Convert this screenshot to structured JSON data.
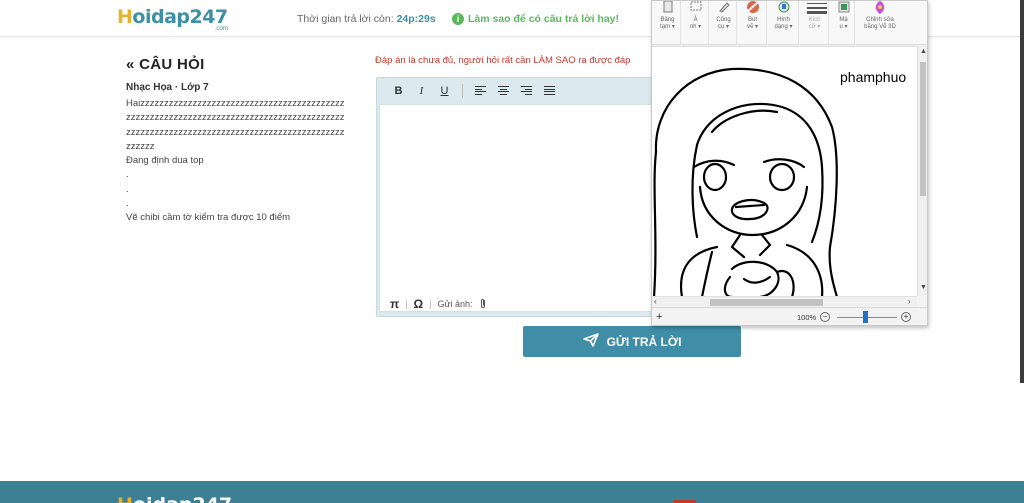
{
  "header": {
    "logo_h": "H",
    "logo_rest": "oidap247",
    "logo_com": ".com",
    "timer_label": "Thời gian trả lời còn:",
    "timer_value": "24p:29s",
    "tip": "Làm sao để có câu trả lời hay!"
  },
  "question": {
    "title": "CÂU HỎI",
    "subject": "Nhạc Họa · Lớp 7",
    "lines": [
      "Haizzzzzzzzzzzzzzzzzzzzzzzzzzzzzzzzzzzzzzzzzzzzzzzzzzzzzzzzzzzzzzzzzzzzzzzzzzzzzzzzzzzzzzzzzzzzzzzzzzzzzzzzzzzzzzzzzzzzzzzzzzzzzzzzzzzzzzzzzzzzz",
      "Đang định dua top",
      ".",
      ".",
      ".",
      "Vẽ chibi cầm tờ kiểm tra được 10 điểm"
    ]
  },
  "answer": {
    "warning": "Đáp án là chưa đủ, người hỏi rất cần LÀM SAO ra được đáp",
    "toolbar": {
      "bold": "B",
      "italic": "I",
      "underline": "U"
    },
    "bottom": {
      "pi": "π",
      "omega": "Ω",
      "send_image": "Gửi ảnh:"
    },
    "submit_label": "GỬI TRẢ LỜI"
  },
  "paint": {
    "groups": [
      "Bảng\ntạm ▾",
      "Ả\nnh ▾",
      "Công\ncụ ▾",
      "Bút\nvẽ ▾",
      "Hình\ndạng ▾",
      "Kích\ncỡ ▾",
      "Mà\nu ▾",
      "Chỉnh sửa\nbằng Vẽ 3D"
    ],
    "canvas_text": "phamphuo",
    "zoom": "100%"
  },
  "footer": {
    "logo_h": "H",
    "logo_rest": "oidap247"
  },
  "colors": {
    "brand": "#3c8fa6",
    "logo_accent": "#e9b22c",
    "tip_green": "#5cb85c",
    "warning_red": "#c0392b",
    "submit_bg": "#3f8da6"
  }
}
